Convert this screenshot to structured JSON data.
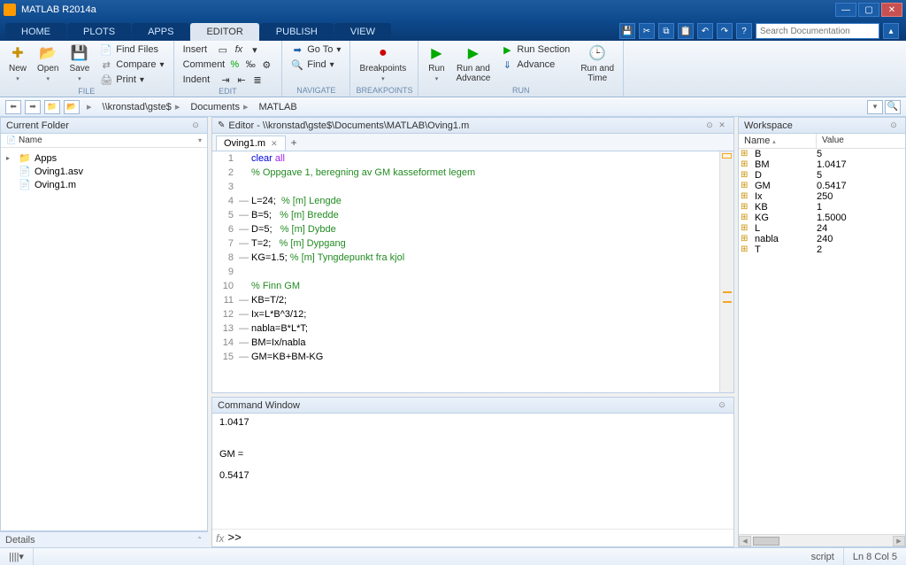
{
  "window": {
    "title": "MATLAB R2014a"
  },
  "tabs": [
    "HOME",
    "PLOTS",
    "APPS",
    "EDITOR",
    "PUBLISH",
    "VIEW"
  ],
  "active_tab": "EDITOR",
  "search": {
    "placeholder": "Search Documentation"
  },
  "ribbon": {
    "file_group": "FILE",
    "edit_group": "EDIT",
    "navigate_group": "NAVIGATE",
    "breakpoints_group": "BREAKPOINTS",
    "run_group": "RUN",
    "new": "New",
    "open": "Open",
    "save": "Save",
    "find_files": "Find Files",
    "compare": "Compare",
    "print": "Print",
    "insert": "Insert",
    "comment": "Comment",
    "indent": "Indent",
    "goto": "Go To",
    "find": "Find",
    "breakpoints": "Breakpoints",
    "run": "Run",
    "run_advance": "Run and\nAdvance",
    "run_section": "Run Section",
    "advance": "Advance",
    "run_time": "Run and\nTime"
  },
  "pathbar": {
    "root": "\\\\kronstad\\gste$",
    "p1": "Documents",
    "p2": "MATLAB"
  },
  "current_folder": {
    "title": "Current Folder",
    "col_name": "Name",
    "items": [
      {
        "name": "Apps",
        "type": "folder"
      },
      {
        "name": "Oving1.asv",
        "type": "file"
      },
      {
        "name": "Oving1.m",
        "type": "file"
      }
    ],
    "details": "Details"
  },
  "editor": {
    "title": "Editor - \\\\kronstad\\gste$\\Documents\\MATLAB\\Oving1.m",
    "tab": "Oving1.m",
    "code": [
      {
        "n": 1,
        "d": false,
        "segs": [
          [
            "kw",
            "clear"
          ],
          [
            "",
            " "
          ],
          [
            "str",
            "all"
          ]
        ]
      },
      {
        "n": 2,
        "d": false,
        "segs": [
          [
            "com",
            "% Oppgave 1, beregning av GM kasseformet legem"
          ]
        ]
      },
      {
        "n": 3,
        "d": false,
        "segs": []
      },
      {
        "n": 4,
        "d": true,
        "segs": [
          [
            "",
            "L=24;  "
          ],
          [
            "com",
            "% [m] Lengde"
          ]
        ]
      },
      {
        "n": 5,
        "d": true,
        "segs": [
          [
            "",
            "B=5;   "
          ],
          [
            "com",
            "% [m] Bredde"
          ]
        ]
      },
      {
        "n": 6,
        "d": true,
        "segs": [
          [
            "",
            "D=5;   "
          ],
          [
            "com",
            "% [m] Dybde"
          ]
        ]
      },
      {
        "n": 7,
        "d": true,
        "segs": [
          [
            "",
            "T=2;   "
          ],
          [
            "com",
            "% [m] Dypgang"
          ]
        ]
      },
      {
        "n": 8,
        "d": true,
        "segs": [
          [
            "",
            "KG=1.5; "
          ],
          [
            "com",
            "% [m] Tyngdepunkt fra kjol"
          ]
        ]
      },
      {
        "n": 9,
        "d": false,
        "segs": []
      },
      {
        "n": 10,
        "d": false,
        "segs": [
          [
            "com",
            "% Finn GM"
          ]
        ]
      },
      {
        "n": 11,
        "d": true,
        "segs": [
          [
            "",
            "KB=T/2;"
          ]
        ]
      },
      {
        "n": 12,
        "d": true,
        "segs": [
          [
            "",
            "Ix=L*B^3/12;"
          ]
        ]
      },
      {
        "n": 13,
        "d": true,
        "segs": [
          [
            "",
            "nabla=B*L*T;"
          ]
        ]
      },
      {
        "n": 14,
        "d": true,
        "segs": [
          [
            "",
            "BM=Ix/nabla"
          ]
        ]
      },
      {
        "n": 15,
        "d": true,
        "segs": [
          [
            "",
            "GM=KB+BM-KG"
          ]
        ]
      }
    ]
  },
  "command_window": {
    "title": "Command Window",
    "lines": [
      "    1.0417",
      "",
      "",
      "GM =",
      "",
      "    0.5417",
      ""
    ],
    "prompt": ">>"
  },
  "workspace": {
    "title": "Workspace",
    "cols": {
      "name": "Name",
      "value": "Value"
    },
    "vars": [
      {
        "name": "B",
        "value": "5"
      },
      {
        "name": "BM",
        "value": "1.0417"
      },
      {
        "name": "D",
        "value": "5"
      },
      {
        "name": "GM",
        "value": "0.5417"
      },
      {
        "name": "Ix",
        "value": "250"
      },
      {
        "name": "KB",
        "value": "1"
      },
      {
        "name": "KG",
        "value": "1.5000"
      },
      {
        "name": "L",
        "value": "24"
      },
      {
        "name": "nabla",
        "value": "240"
      },
      {
        "name": "T",
        "value": "2"
      }
    ]
  },
  "status": {
    "mode": "script",
    "pos": "Ln  8    Col  5"
  }
}
